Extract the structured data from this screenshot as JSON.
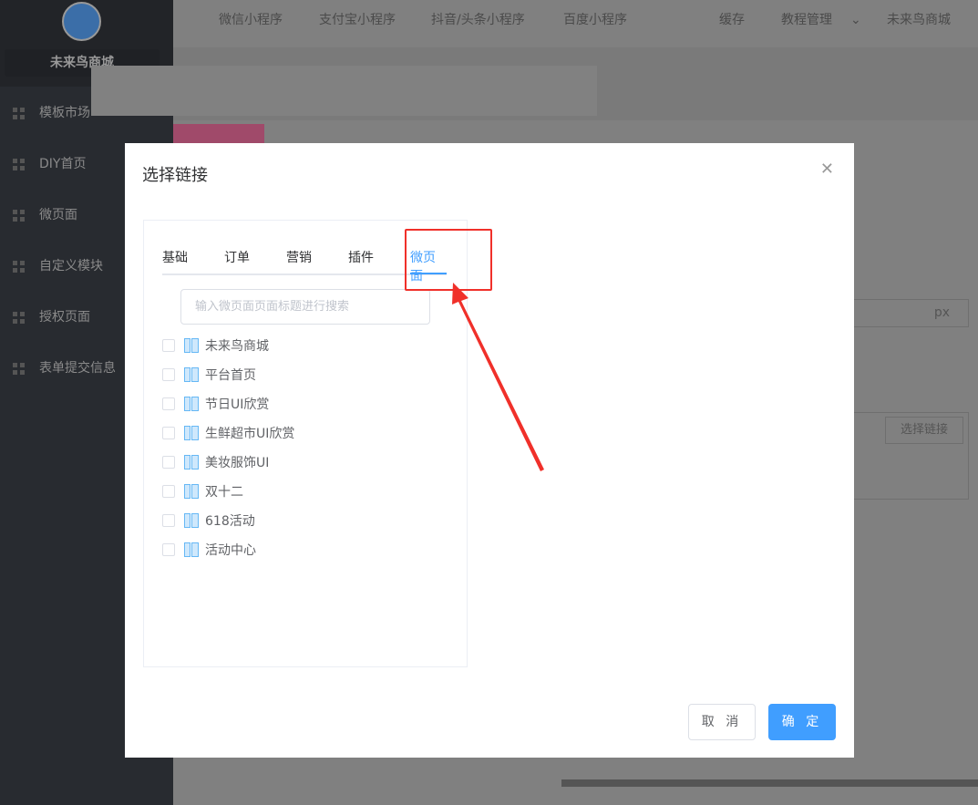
{
  "sidebar": {
    "shop_name": "未来鸟商城",
    "items": [
      {
        "label": "模板市场"
      },
      {
        "label": "DIY首页"
      },
      {
        "label": "微页面"
      },
      {
        "label": "自定义模块"
      },
      {
        "label": "授权页面"
      },
      {
        "label": "表单提交信息"
      }
    ]
  },
  "topnav": {
    "items": [
      "微信小程序",
      "支付宝小程序",
      "抖音/头条小程序",
      "百度小程序",
      "缓存",
      "教程管理",
      "未来鸟商城"
    ]
  },
  "background": {
    "unit": "px",
    "link_button": "选择链接"
  },
  "modal": {
    "title": "选择链接",
    "tabs": [
      "基础",
      "订单",
      "营销",
      "插件",
      "微页面"
    ],
    "active_tab": "微页面",
    "search_placeholder": "输入微页面页面标题进行搜索",
    "pages": [
      "未来鸟商城",
      "平台首页",
      "节日UI欣赏",
      "生鲜超市UI欣赏",
      "美妆服饰UI",
      "双十二",
      "618活动",
      "活动中心"
    ],
    "cancel": "取 消",
    "confirm": "确 定"
  },
  "colors": {
    "accent": "#409eff",
    "annotation": "#f0302a"
  }
}
